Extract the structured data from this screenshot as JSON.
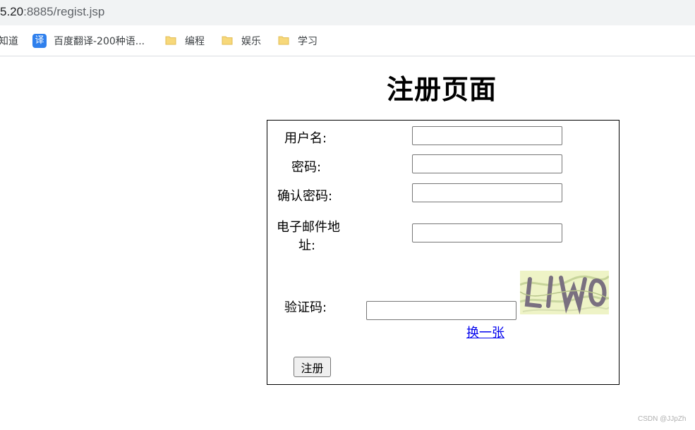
{
  "browser": {
    "url_prefix": "5.20",
    "url_rest": ":8885/regist.jsp",
    "bookmarks": [
      {
        "label": "知道",
        "icon": "partial-icon"
      },
      {
        "label": "百度翻译-200种语...",
        "icon": "translate-icon",
        "icon_text": "译"
      },
      {
        "label": "编程",
        "icon": "folder-icon"
      },
      {
        "label": "娱乐",
        "icon": "folder-icon"
      },
      {
        "label": "学习",
        "icon": "folder-icon"
      }
    ]
  },
  "page": {
    "title": "注册页面",
    "form": {
      "username_label": "用户名:",
      "password_label": "密码:",
      "confirm_label": "确认密码:",
      "email_label_line1": "电子邮件地",
      "email_label_line2": "址:",
      "captcha_label": "验证码:",
      "captcha_text": "LIWO",
      "refresh_link": "换一张",
      "submit_label": "注册"
    }
  },
  "watermark": "CSDN @JJpZh",
  "colors": {
    "link": "#0000ee",
    "folder": "#f7d87a",
    "translate_icon": "#2f80ed"
  }
}
